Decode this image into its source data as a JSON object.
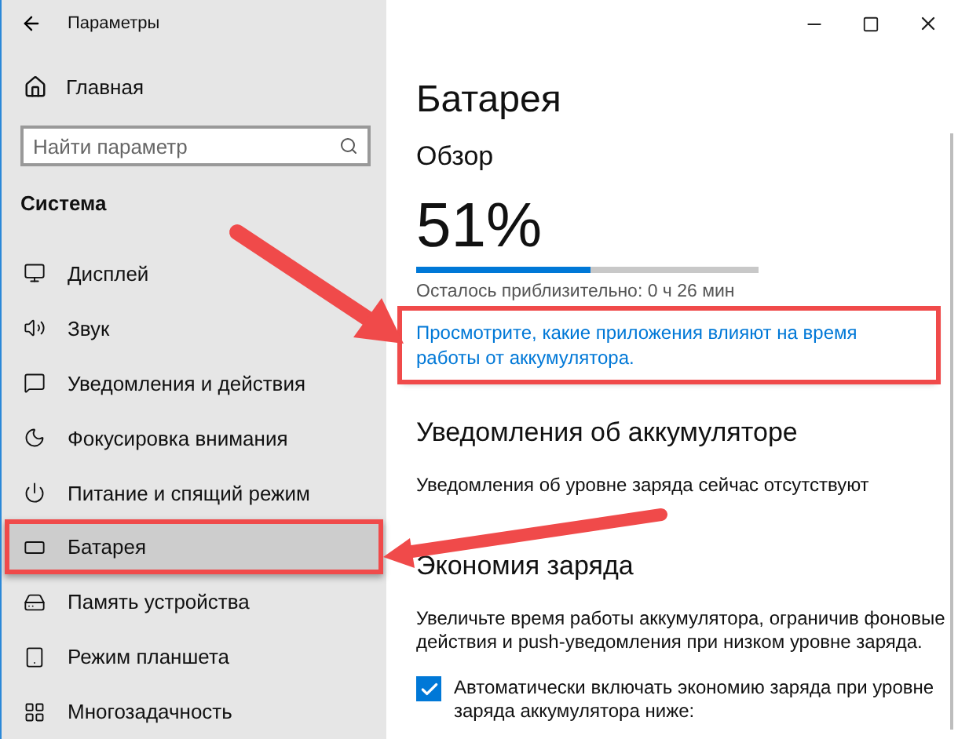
{
  "window": {
    "title": "Параметры"
  },
  "sidebar": {
    "home": "Главная",
    "search": {
      "placeholder": "Найти параметр"
    },
    "section": "Система",
    "items": [
      {
        "label": "Дисплей",
        "selected": false,
        "annotated": false
      },
      {
        "label": "Звук",
        "selected": false,
        "annotated": false
      },
      {
        "label": "Уведомления и действия",
        "selected": false,
        "annotated": false
      },
      {
        "label": "Фокусировка внимания",
        "selected": false,
        "annotated": false
      },
      {
        "label": "Питание и спящий режим",
        "selected": false,
        "annotated": false
      },
      {
        "label": "Батарея",
        "selected": true,
        "annotated": true
      },
      {
        "label": "Память устройства",
        "selected": false,
        "annotated": false
      },
      {
        "label": "Режим планшета",
        "selected": false,
        "annotated": false
      },
      {
        "label": "Многозадачность",
        "selected": false,
        "annotated": false
      }
    ]
  },
  "content": {
    "title": "Батарея",
    "overview": {
      "heading": "Обзор",
      "percent": "51%",
      "level": 0.51,
      "remaining": "Осталось приблизительно: 0 ч 26 мин",
      "link": {
        "text": "Просмотрите, какие приложения влияют на время работы от аккумулятора.",
        "annotated": true
      }
    },
    "notifications": {
      "heading": "Уведомления об аккумуляторе",
      "text": "Уведомления об уровне заряда сейчас отсутствуют"
    },
    "saver": {
      "heading": "Экономия заряда",
      "text": "Увеличьте время работы аккумулятора, ограничив фоновые действия и push-уведомления при низком уровне заряда.",
      "auto": {
        "label": "Автоматически включать экономию заряда при уровне заряда аккумулятора ниже:",
        "checked": true
      }
    }
  }
}
